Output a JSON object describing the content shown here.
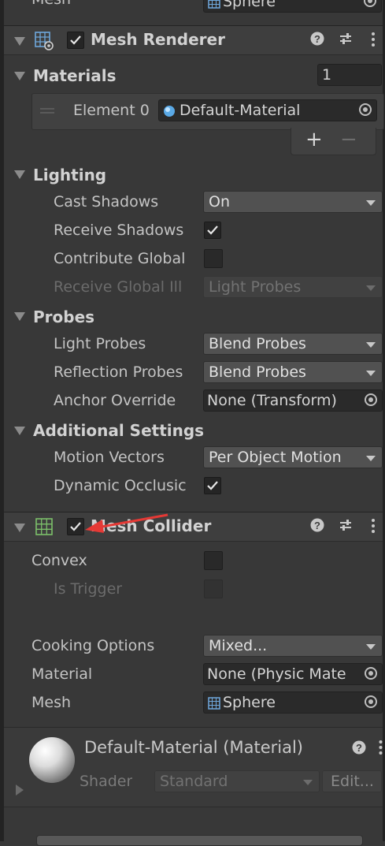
{
  "top_partial": {
    "label": "Mesh",
    "value": "Sphere"
  },
  "mesh_renderer": {
    "title": "Mesh Renderer",
    "enabled": true,
    "materials": {
      "label": "Materials",
      "size": "1",
      "element_label": "Element 0",
      "element_value": "Default-Material",
      "add": "+",
      "remove": "−"
    },
    "lighting": {
      "label": "Lighting",
      "cast_shadows_label": "Cast Shadows",
      "cast_shadows_value": "On",
      "receive_shadows_label": "Receive Shadows",
      "contribute_gi_label": "Contribute Global",
      "receive_gi_label": "Receive Global Ill",
      "receive_gi_value": "Light Probes"
    },
    "probes": {
      "label": "Probes",
      "light_probes_label": "Light Probes",
      "light_probes_value": "Blend Probes",
      "reflection_probes_label": "Reflection Probes",
      "reflection_probes_value": "Blend Probes",
      "anchor_override_label": "Anchor Override",
      "anchor_override_value": "None (Transform)"
    },
    "additional": {
      "label": "Additional Settings",
      "motion_vectors_label": "Motion Vectors",
      "motion_vectors_value": "Per Object Motion",
      "dynamic_occlusion_label": "Dynamic Occlusic"
    }
  },
  "mesh_collider": {
    "title": "Mesh Collider",
    "enabled": true,
    "convex_label": "Convex",
    "is_trigger_label": "Is Trigger",
    "cooking_label": "Cooking Options",
    "cooking_value": "Mixed...",
    "material_label": "Material",
    "material_value": "None (Physic Mate",
    "mesh_label": "Mesh",
    "mesh_value": "Sphere"
  },
  "material_preview": {
    "title": "Default-Material (Material)",
    "shader_label": "Shader",
    "shader_value": "Standard",
    "edit_label": "Edit..."
  },
  "colors": {
    "background": "#383838",
    "header": "#3e3e3e",
    "annotation_arrow": "#e53935",
    "mesh_icon": "#6fa8dc",
    "collider_icon": "#7cc06a"
  }
}
